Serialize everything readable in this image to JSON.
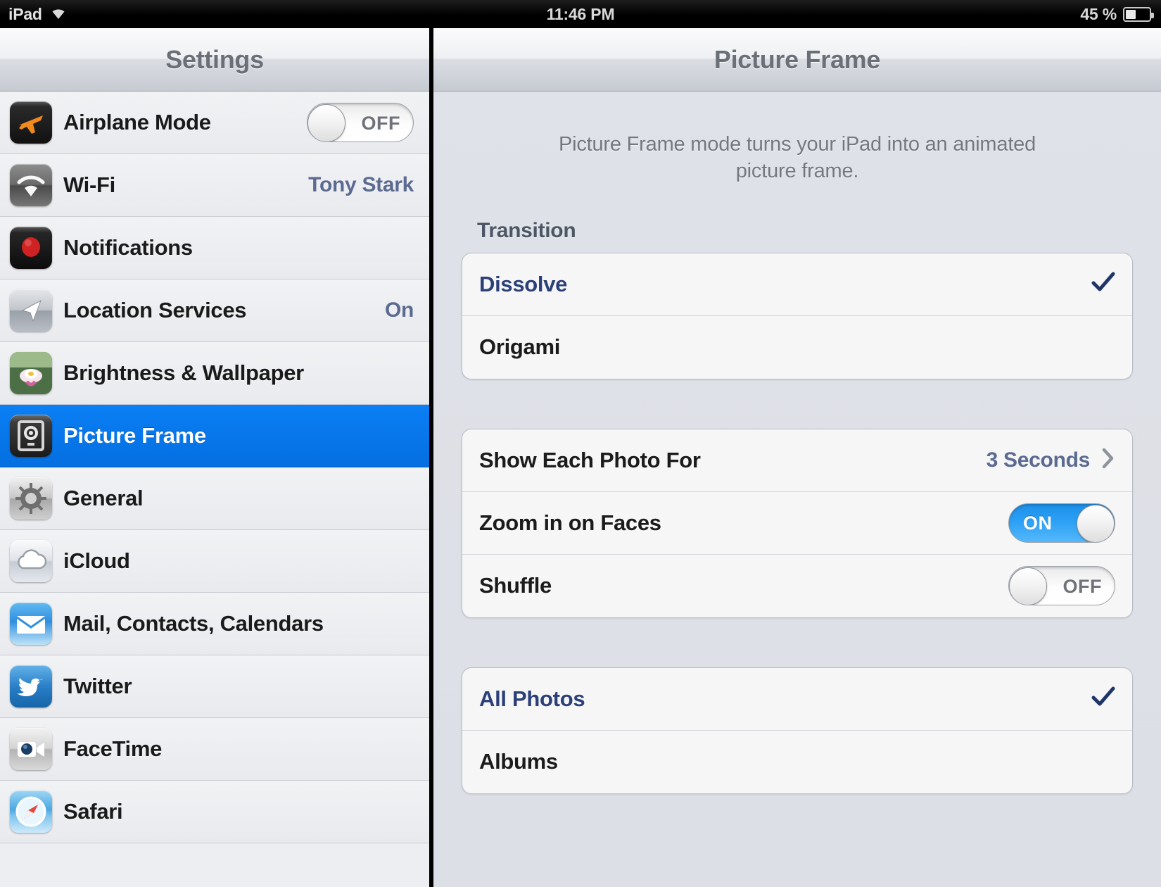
{
  "status_bar": {
    "device": "iPad",
    "wifi_icon": "wifi-icon",
    "time": "11:46 PM",
    "battery_percent": "45 %",
    "battery_level": 45
  },
  "sidebar": {
    "title": "Settings",
    "items": [
      {
        "label": "Airplane Mode",
        "icon": "airplane-icon",
        "control": "toggle",
        "toggle_state": "OFF",
        "selected": false
      },
      {
        "label": "Wi-Fi",
        "icon": "wifi-signal-icon",
        "value": "Tony Stark",
        "selected": false
      },
      {
        "label": "Notifications",
        "icon": "notifications-icon",
        "selected": false
      },
      {
        "label": "Location Services",
        "icon": "location-arrow-icon",
        "value": "On",
        "selected": false
      },
      {
        "label": "Brightness & Wallpaper",
        "icon": "flower-wallpaper-icon",
        "selected": false
      },
      {
        "label": "Picture Frame",
        "icon": "picture-frame-icon",
        "selected": true
      },
      {
        "label": "General",
        "icon": "gear-icon",
        "selected": false
      },
      {
        "label": "iCloud",
        "icon": "cloud-icon",
        "selected": false
      },
      {
        "label": "Mail, Contacts, Calendars",
        "icon": "mail-envelope-icon",
        "selected": false
      },
      {
        "label": "Twitter",
        "icon": "twitter-bird-icon",
        "selected": false
      },
      {
        "label": "FaceTime",
        "icon": "facetime-camera-icon",
        "selected": false
      },
      {
        "label": "Safari",
        "icon": "safari-compass-icon",
        "selected": false
      }
    ]
  },
  "detail": {
    "title": "Picture Frame",
    "description": "Picture Frame mode turns your iPad into an animated picture frame.",
    "transition_header": "Transition",
    "transition_options": [
      {
        "label": "Dissolve",
        "selected": true
      },
      {
        "label": "Origami",
        "selected": false
      }
    ],
    "settings_rows": [
      {
        "label": "Show Each Photo For",
        "value": "3 Seconds",
        "control": "disclosure"
      },
      {
        "label": "Zoom in on Faces",
        "control": "toggle",
        "toggle_state": "ON"
      },
      {
        "label": "Shuffle",
        "control": "toggle",
        "toggle_state": "OFF"
      }
    ],
    "source_options": [
      {
        "label": "All Photos",
        "selected": true
      },
      {
        "label": "Albums",
        "selected": false
      }
    ]
  },
  "colors": {
    "selection_blue": "#0b7ff5",
    "toggle_on_blue": "#2ba0f5",
    "link_navy": "#2b3f78",
    "value_blue": "#5b6a90",
    "checkmark_navy": "#1f3566"
  }
}
